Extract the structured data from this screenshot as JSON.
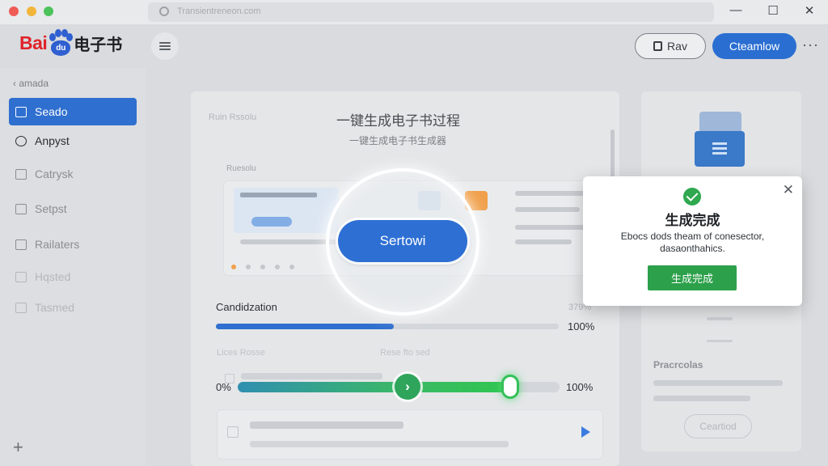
{
  "window": {
    "url_text": "Transientreneon.com",
    "controls": {
      "minimize": "—",
      "maximize": "☐",
      "close": "✕"
    }
  },
  "header": {
    "logo_bai": "Bai",
    "logo_du": "du",
    "logo_ebook": "电子书",
    "outline_button_label": "Rav",
    "primary_button_label": "Cteamlow",
    "more": "···"
  },
  "sidebar": {
    "back_label": "‹ amada",
    "items": [
      {
        "label": "Seado",
        "icon": "home-icon",
        "state": "active"
      },
      {
        "label": "Anpyst",
        "icon": "gear-icon",
        "state": "bold"
      },
      {
        "label": "Catrysk",
        "icon": "folder-icon",
        "state": "normal"
      },
      {
        "label": "Setpst",
        "icon": "list-icon",
        "state": "normal"
      },
      {
        "label": "Railaters",
        "icon": "folder-icon",
        "state": "normal"
      },
      {
        "label": "Hqsted",
        "icon": "box-icon",
        "state": "faded"
      },
      {
        "label": "Tasmed",
        "icon": "chart-icon",
        "state": "faded"
      }
    ],
    "add_label": "+"
  },
  "main": {
    "crumb": "Ruin  Rssolu",
    "title": "一键生成电子书过程",
    "subtitle": "一键生成电子书生成器",
    "section_label": "Ruesolu",
    "progress1": {
      "label": "Candidzation",
      "value_top": "379%",
      "percent": 0.52,
      "percent_label": "100%"
    },
    "ghost_left": "Lices Rosse",
    "ghost_mid": "Rese fto sed",
    "progress2": {
      "left_label": "0%",
      "right_label": "100%",
      "percent": 0.85
    },
    "spotlight_button": "Sertowi"
  },
  "right_panel": {
    "title": "Pracrcolas",
    "button": "Ceartiod"
  },
  "dialog": {
    "title": "生成完成",
    "message": "Ebocs dods theam of conesector, dasaonthahics.",
    "button": "生成完成",
    "close": "✕"
  },
  "colors": {
    "accent": "#2f6fcf",
    "success": "#2ca04a",
    "brand_red": "#e0242b",
    "brand_blue": "#2f5fd0"
  }
}
